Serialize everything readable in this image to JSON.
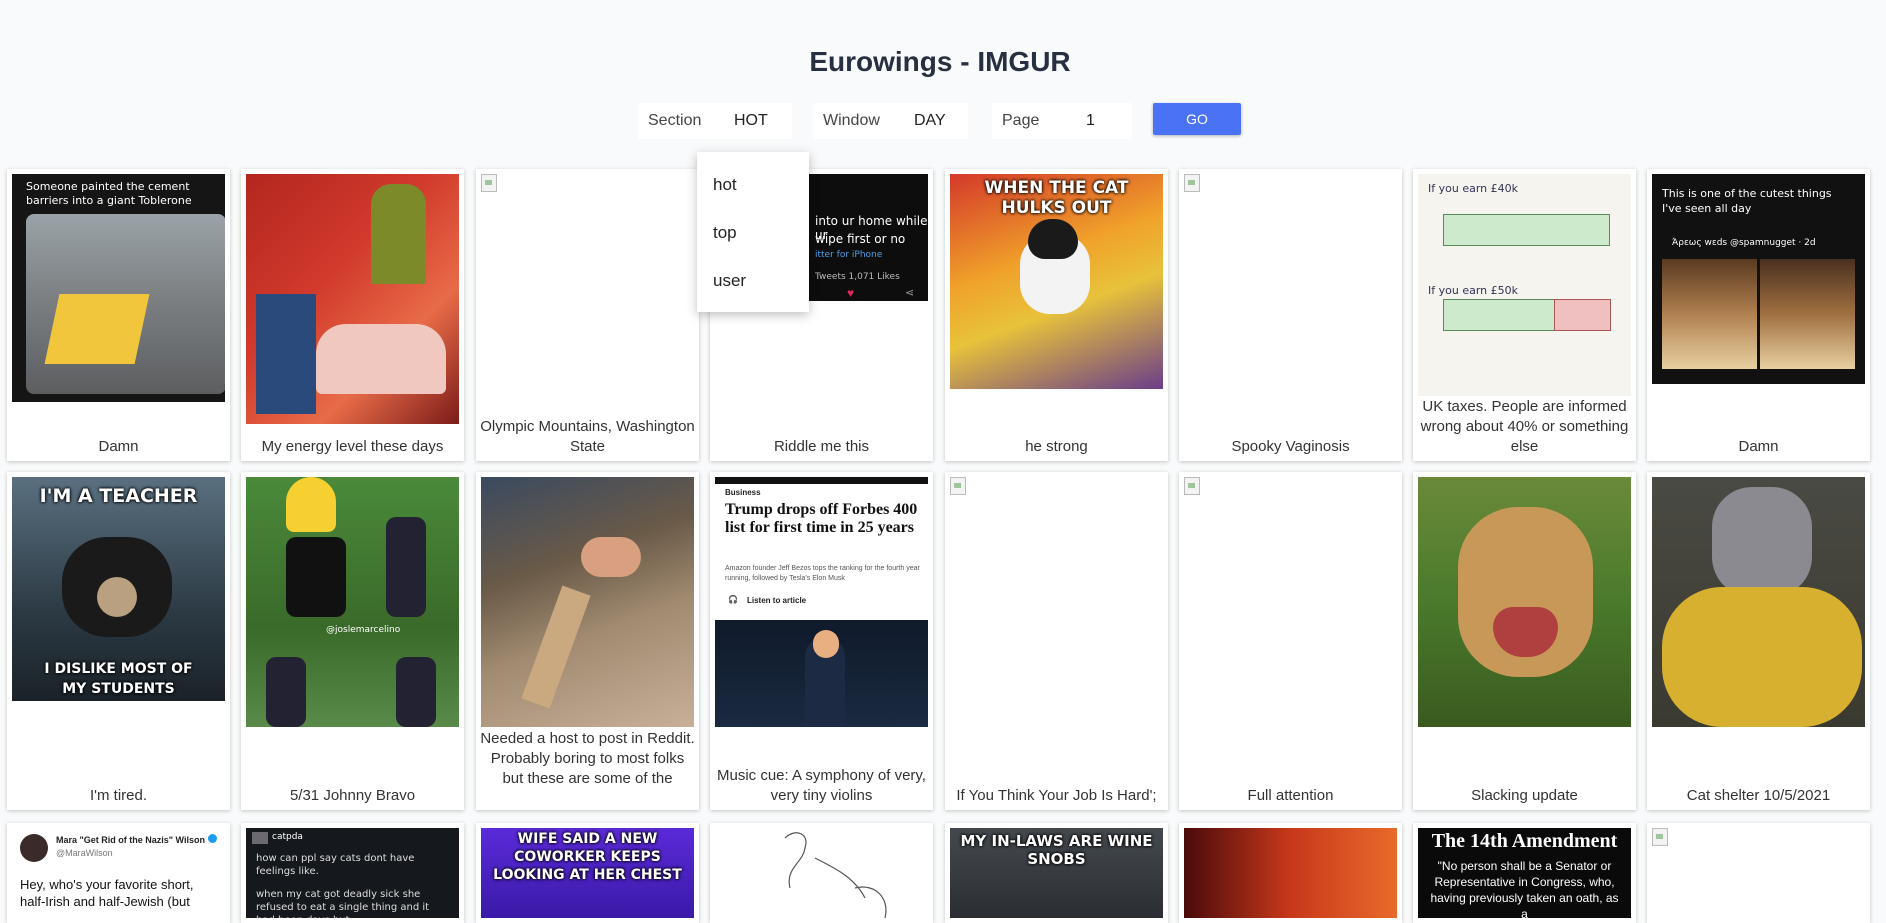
{
  "header": {
    "title": "Eurowings - IMGUR"
  },
  "controls": {
    "section_label": "Section",
    "section_value": "HOT",
    "window_label": "Window",
    "window_value": "DAY",
    "page_label": "Page",
    "page_value": "1",
    "go_label": "GO"
  },
  "dropdown": {
    "options": [
      "hot",
      "top",
      "user"
    ]
  },
  "posts_row1": [
    "Damn",
    "My energy level these days",
    "Olympic Mountains, Washington State",
    "Riddle me this",
    "he strong",
    "Spooky Vaginosis",
    "UK taxes. People are informed wrong about 40% or something else",
    "Damn"
  ],
  "posts_row2": [
    "I'm tired.",
    "5/31 Johnny Bravo",
    "Needed a host to post in Reddit. Probably boring to most folks but these are some of the",
    "Music cue: A symphony of very, very tiny violins",
    "If You Think Your Job Is Hard';",
    "Full attention",
    "Slacking update",
    "Cat shelter 10/5/2021"
  ],
  "image_text": {
    "toblerone": "Someone painted the cement barriers into a giant Toblerone",
    "riddle_line1": "into ur home while ur",
    "riddle_line2": "wipe first or no",
    "riddle_src": "itter for iPhone",
    "riddle_stats": "Tweets  1,071 Likes",
    "cat_hulk": "WHEN THE CAT HULKS OUT",
    "taxes_top": "If you earn £40k",
    "taxes_mid": "If you earn £50k",
    "cutest": "This is one of the cutest things I've seen all day",
    "cutest_user": "Άρεως wεds @spamnugget · 2d",
    "teacher_top": "I'M A TEACHER",
    "teacher_bottom": "I DISLIKE MOST OF MY STUDENTS",
    "bravo_tag": "@joslemarcelino",
    "trump_section": "Business",
    "trump_headline": "Trump drops off Forbes 400 list for first time in 25 years",
    "trump_sub": "Amazon founder Jeff Bezos tops the ranking for the fourth year running, followed by Tesla's Elon Musk",
    "trump_listen": "Listen to article",
    "r3_wilson_name": "Mara \"Get Rid of the Nazis\" Wilson",
    "r3_wilson_handle": "@MaraWilson",
    "r3_wilson_text": "Hey, who's your favorite short, half-Irish and half-Jewish (but",
    "r3_catpda_user": "catpda",
    "r3_catpda_text": "how can ppl say cats dont have feelings like.",
    "r3_catpda_text2": "when my cat got deadly sick she refused to eat a single thing and it had been days but",
    "r3_coworker": "WIFE SAID A NEW COWORKER KEEPS LOOKING AT HER CHEST",
    "r3_inlaws": "MY IN-LAWS ARE WINE SNOBS",
    "r3_amend_title": "The 14th Amendment",
    "r3_amend_text": "\"No person shall be a Senator or Representative in Congress, who, having previously taken an oath, as a"
  }
}
